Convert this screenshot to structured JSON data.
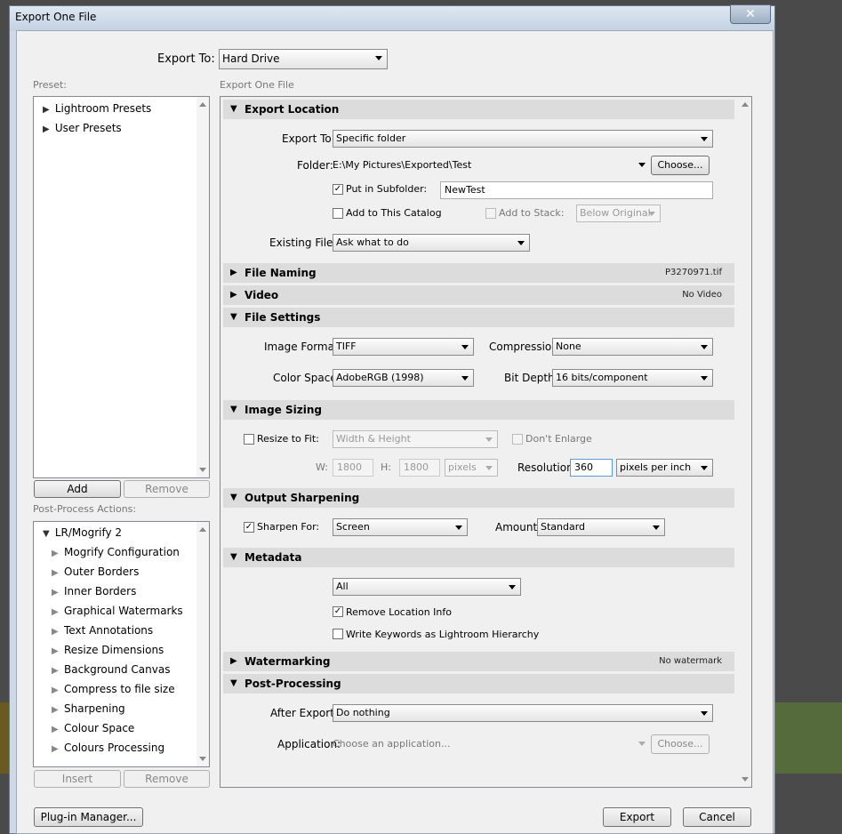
{
  "window": {
    "title": "Export One File",
    "close_glyph": "✕"
  },
  "top": {
    "export_to_label": "Export To:",
    "export_to_value": "Hard Drive"
  },
  "preset": {
    "label": "Preset:",
    "items": [
      "Lightroom Presets",
      "User Presets"
    ],
    "add_label": "Add",
    "remove_label": "Remove"
  },
  "post_process": {
    "label": "Post-Process Actions:",
    "root": "LR/Mogrify 2",
    "items": [
      "Mogrify Configuration",
      "Outer Borders",
      "Inner Borders",
      "Graphical Watermarks",
      "Text Annotations",
      "Resize Dimensions",
      "Background Canvas",
      "Compress to file size",
      "Sharpening",
      "Colour Space",
      "Colours Processing"
    ],
    "insert_label": "Insert",
    "remove_label": "Remove"
  },
  "right_header": "Export One File",
  "export_location": {
    "title": "Export Location",
    "export_to_label": "Export To:",
    "export_to_value": "Specific folder",
    "folder_label": "Folder:",
    "folder_value": "E:\\My Pictures\\Exported\\Test",
    "choose_label": "Choose...",
    "subfolder_label": "Put in Subfolder:",
    "subfolder_checked": true,
    "subfolder_value": "NewTest",
    "add_catalog_label": "Add to This Catalog",
    "add_stack_label": "Add to Stack:",
    "stack_value": "Below Original",
    "existing_label": "Existing Files:",
    "existing_value": "Ask what to do"
  },
  "file_naming": {
    "title": "File Naming",
    "summary": "P3270971.tif"
  },
  "video": {
    "title": "Video",
    "summary": "No Video"
  },
  "file_settings": {
    "title": "File Settings",
    "format_label": "Image Format:",
    "format_value": "TIFF",
    "compression_label": "Compression:",
    "compression_value": "None",
    "colorspace_label": "Color Space:",
    "colorspace_value": "AdobeRGB (1998)",
    "bitdepth_label": "Bit Depth:",
    "bitdepth_value": "16 bits/component"
  },
  "image_sizing": {
    "title": "Image Sizing",
    "resize_label": "Resize to Fit:",
    "resize_value": "Width & Height",
    "dont_enlarge_label": "Don't Enlarge",
    "w_label": "W:",
    "w_value": "1800",
    "h_label": "H:",
    "h_value": "1800",
    "units_value": "pixels",
    "resolution_label": "Resolution:",
    "resolution_value": "360",
    "resolution_units": "pixels per inch"
  },
  "output_sharpening": {
    "title": "Output Sharpening",
    "sharpen_label": "Sharpen For:",
    "sharpen_value": "Screen",
    "amount_label": "Amount:",
    "amount_value": "Standard"
  },
  "metadata": {
    "title": "Metadata",
    "value": "All",
    "remove_location_label": "Remove Location Info",
    "write_keywords_label": "Write Keywords as Lightroom Hierarchy"
  },
  "watermarking": {
    "title": "Watermarking",
    "summary": "No watermark"
  },
  "post_processing": {
    "title": "Post-Processing",
    "after_label": "After Export:",
    "after_value": "Do nothing",
    "app_label": "Application:",
    "app_placeholder": "Choose an application...",
    "choose_label": "Choose..."
  },
  "footer": {
    "plugin_manager_label": "Plug-in Manager...",
    "export_label": "Export",
    "cancel_label": "Cancel"
  },
  "glyphs": {
    "collapsed": "▶",
    "expanded": "▼",
    "check": "✓"
  }
}
